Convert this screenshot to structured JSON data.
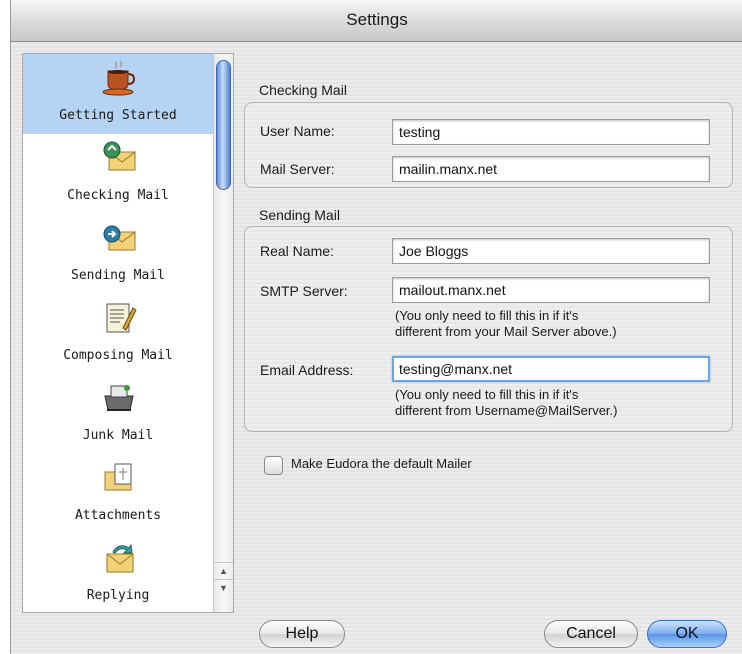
{
  "window": {
    "title": "Settings"
  },
  "sidebar": {
    "items": [
      {
        "label": "Getting Started",
        "icon": "coffee-cup-icon",
        "selected": true
      },
      {
        "label": "Checking Mail",
        "icon": "checking-mail-icon",
        "selected": false
      },
      {
        "label": "Sending Mail",
        "icon": "sending-mail-icon",
        "selected": false
      },
      {
        "label": "Composing Mail",
        "icon": "composing-mail-icon",
        "selected": false
      },
      {
        "label": "Junk Mail",
        "icon": "junk-mail-icon",
        "selected": false
      },
      {
        "label": "Attachments",
        "icon": "attachments-icon",
        "selected": false
      },
      {
        "label": "Replying",
        "icon": "replying-icon",
        "selected": false
      }
    ]
  },
  "checking": {
    "heading": "Checking Mail",
    "username_label": "User Name:",
    "username_value": "testing",
    "server_label": "Mail Server:",
    "server_value": "mailin.manx.net"
  },
  "sending": {
    "heading": "Sending Mail",
    "realname_label": "Real Name:",
    "realname_value": "Joe Bloggs",
    "smtp_label": "SMTP Server:",
    "smtp_value": "mailout.manx.net",
    "smtp_hint_1": "(You only need to fill this in if it's",
    "smtp_hint_2": "different from your Mail Server above.)",
    "email_label": "Email Address:",
    "email_value": "testing@manx.net",
    "email_hint_1": "(You only need to fill this in if it's",
    "email_hint_2": "different from Username@MailServer.)"
  },
  "default_mailer": {
    "label": "Make Eudora the default Mailer",
    "checked": false
  },
  "buttons": {
    "help": "Help",
    "cancel": "Cancel",
    "ok": "OK"
  },
  "colors": {
    "selection": "#b5d3f3",
    "default_button": "#5a94e6",
    "focus_ring": "#6fa3e6"
  }
}
